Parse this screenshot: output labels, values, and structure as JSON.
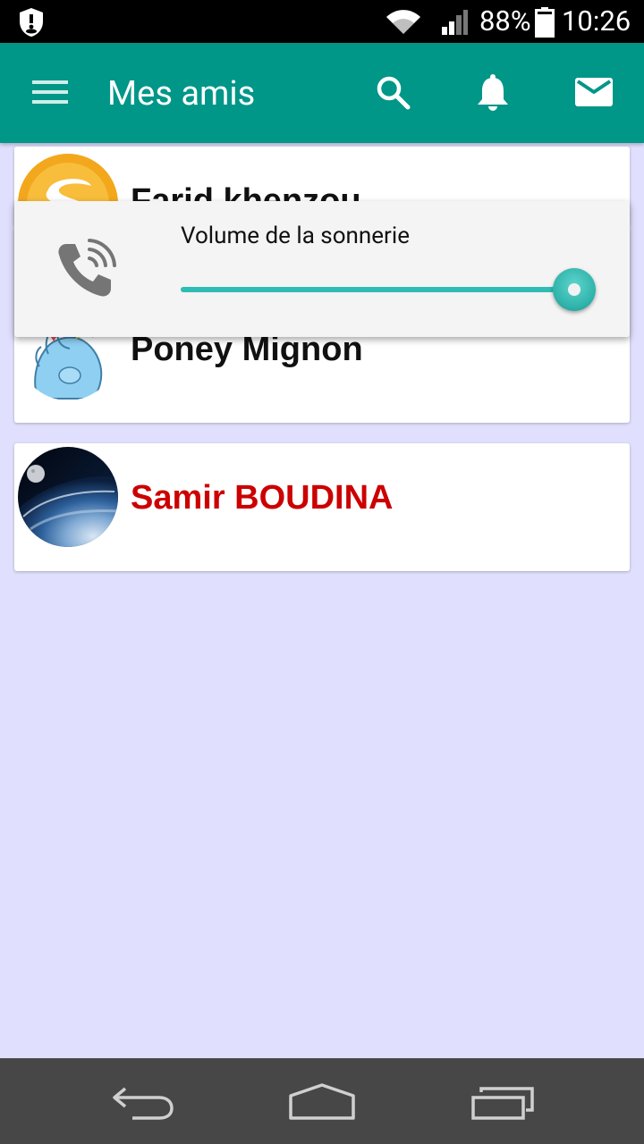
{
  "status_bar": {
    "battery_percent": "88%",
    "time": "10:26",
    "icons": [
      "shield-icon",
      "wifi-icon",
      "signal-icon",
      "battery-icon"
    ]
  },
  "app_bar": {
    "title": "Mes amis",
    "icons": [
      "menu-icon",
      "search-icon",
      "bell-icon",
      "mail-icon"
    ]
  },
  "friends": [
    {
      "name": "Farid khenzou",
      "name_color": "#111111"
    },
    {
      "name": "Poney Mignon",
      "name_color": "#111111"
    },
    {
      "name": "Samir BOUDINA",
      "name_color": "#cc0000"
    }
  ],
  "volume_dialog": {
    "label": "Volume de la sonnerie",
    "level": 1.0,
    "icon": "phone-ringing-icon"
  },
  "nav_bar": {
    "icons": [
      "back-icon",
      "home-icon",
      "recent-apps-icon"
    ]
  },
  "colors": {
    "app_bar": "#009688",
    "background": "#e0e0fe",
    "accent": "#2ebcb4",
    "highlight_name": "#cc0000"
  }
}
